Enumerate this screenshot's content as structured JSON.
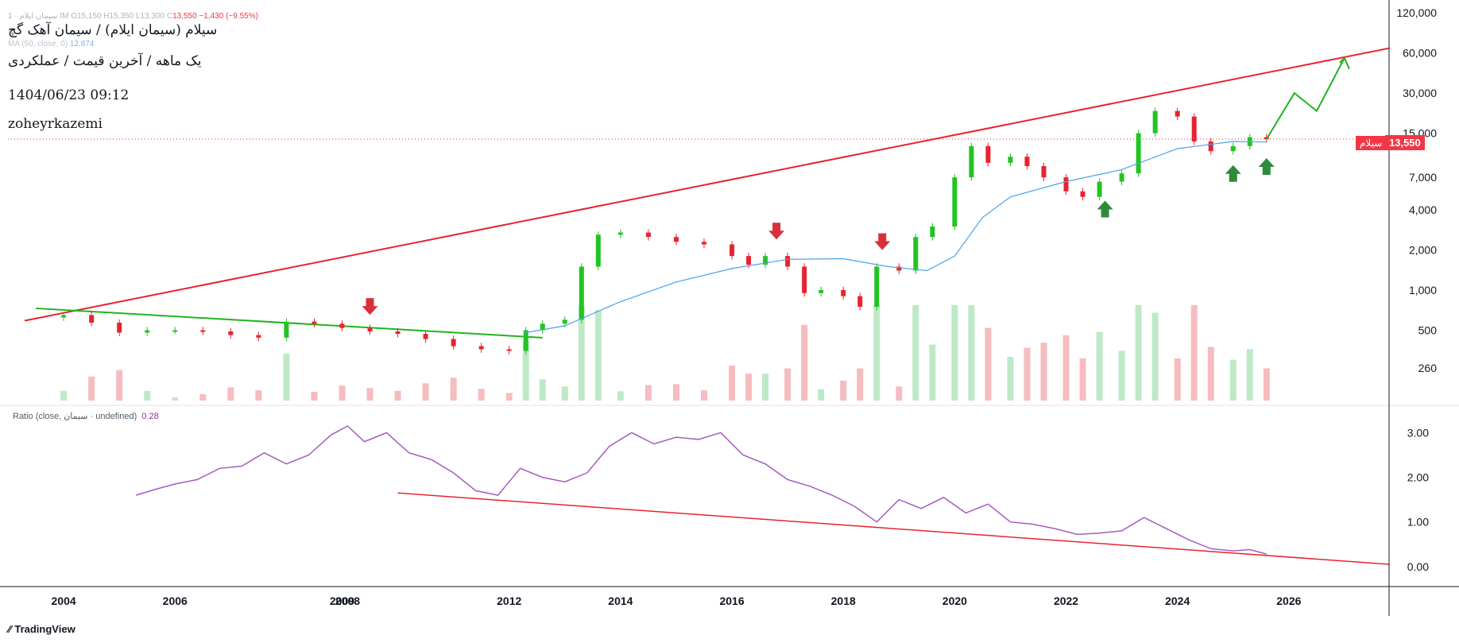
{
  "header": {
    "ohlc_prefix": "ا سیمان ایلام · 1M",
    "ohlc_values": "O15,150 H15,350 L13,300 C",
    "ohlc_close": "13,550 −1,430 (−9.55%)",
    "title": "سیلام (سیمان ایلام) / سیمان آهک گچ",
    "subtitle": "یک ماهه / آخرین قیمت / عملکردی",
    "datetime": "1404/06/23 09:12",
    "author": "zoheyrkazemi",
    "ma_label": "MA (50, close, 0)",
    "ma_value": "12,874"
  },
  "price_badge": {
    "symbol": "سیلام",
    "value": "13,550"
  },
  "ratio_legend": {
    "label": "Ratio (close, سیمان · undefined)",
    "value": "0.28"
  },
  "footer": {
    "brand": "TradingView"
  },
  "colors": {
    "up": "#22c422",
    "down": "#e8232f",
    "ma": "#4aa3e8",
    "ratio": "#a55cbf",
    "trend_red": "#e8232f",
    "trend_green": "#22b31e",
    "arrow_red": "#d8303a",
    "arrow_green": "#2e8b3a"
  },
  "chart_data": [
    {
      "type": "candlestick",
      "scale": "log",
      "price_axis_ticks": [
        "120,000",
        "60,000",
        "30,000",
        "15,000",
        "7,000",
        "4,000",
        "2,000",
        "1,000",
        "500",
        "260"
      ],
      "x_axis_ticks": [
        "2004",
        "2006",
        "2008",
        "2009",
        "2012",
        "2014",
        "2016",
        "2018",
        "2020",
        "2022",
        "2024",
        "2026"
      ],
      "ylim": [
        180,
        120000
      ],
      "xlim": [
        2003.0,
        2027.8
      ],
      "last_price": 13550,
      "series": [
        {
          "name": "close",
          "x": [
            2004.0,
            2004.5,
            2005.0,
            2005.5,
            2006.0,
            2006.5,
            2007.0,
            2007.5,
            2008.0,
            2008.5,
            2009.0,
            2009.5,
            2010.0,
            2010.5,
            2011.0,
            2011.5,
            2012.0,
            2012.3,
            2012.6,
            2013.0,
            2013.3,
            2013.6,
            2014.0,
            2014.5,
            2015.0,
            2015.5,
            2016.0,
            2016.3,
            2016.6,
            2017.0,
            2017.3,
            2017.6,
            2018.0,
            2018.3,
            2018.6,
            2019.0,
            2019.3,
            2019.6,
            2020.0,
            2020.3,
            2020.6,
            2021.0,
            2021.3,
            2021.6,
            2022.0,
            2022.3,
            2022.6,
            2023.0,
            2023.3,
            2023.6,
            2024.0,
            2024.3,
            2024.6,
            2025.0,
            2025.3,
            2025.6
          ],
          "values": [
            650,
            570,
            480,
            500,
            500,
            490,
            460,
            440,
            580,
            560,
            520,
            490,
            470,
            430,
            380,
            360,
            350,
            500,
            560,
            600,
            1500,
            2600,
            2700,
            2500,
            2300,
            2200,
            1800,
            1550,
            1800,
            1500,
            950,
            1000,
            900,
            750,
            1500,
            1400,
            2500,
            3000,
            7000,
            12000,
            9000,
            10000,
            8500,
            7000,
            5500,
            5000,
            6500,
            7500,
            15000,
            22000,
            20000,
            13000,
            11000,
            12000,
            14000,
            13550
          ]
        },
        {
          "name": "MA 50",
          "x": [
            2012.3,
            2013.0,
            2014.0,
            2015.0,
            2016.0,
            2017.0,
            2018.0,
            2018.8,
            2019.5,
            2020.0,
            2020.5,
            2021.0,
            2022.0,
            2023.0,
            2024.0,
            2025.0,
            2025.6
          ],
          "values": [
            480,
            540,
            820,
            1150,
            1450,
            1700,
            1720,
            1500,
            1400,
            1800,
            3500,
            5000,
            6500,
            8000,
            11500,
            13000,
            12874
          ]
        }
      ],
      "annotations": {
        "red_trendline": {
          "from": [
            2003.3,
            590
          ],
          "to": [
            2027.8,
            65000
          ]
        },
        "green_trendline": {
          "from": [
            2003.5,
            730
          ],
          "to": [
            2012.6,
            440
          ]
        },
        "green_projection": {
          "x": [
            2025.6,
            2026.1,
            2026.5,
            2027.0
          ],
          "values": [
            13550,
            30000,
            22000,
            55000
          ]
        },
        "red_down_arrows_x": [
          2009.5,
          2016.8,
          2018.7
        ],
        "green_up_arrows_x": [
          2022.7,
          2025.0,
          2025.6
        ]
      }
    },
    {
      "type": "line",
      "name": "Ratio (close, سیمان · undefined)",
      "y_axis_ticks": [
        "3.00",
        "2.00",
        "1.00",
        "0.00"
      ],
      "ylim": [
        -0.2,
        3.4
      ],
      "last_value": 0.28,
      "series": [
        {
          "name": "ratio",
          "x": [
            2005.3,
            2005.7,
            2006.0,
            2006.4,
            2006.8,
            2007.2,
            2007.6,
            2008.0,
            2008.4,
            2008.8,
            2009.1,
            2009.4,
            2009.8,
            2010.2,
            2010.6,
            2011.0,
            2011.4,
            2011.8,
            2012.2,
            2012.6,
            2013.0,
            2013.4,
            2013.8,
            2014.2,
            2014.6,
            2015.0,
            2015.4,
            2015.8,
            2016.2,
            2016.6,
            2017.0,
            2017.4,
            2017.8,
            2018.2,
            2018.6,
            2019.0,
            2019.4,
            2019.8,
            2020.2,
            2020.6,
            2021.0,
            2021.4,
            2021.8,
            2022.2,
            2022.6,
            2023.0,
            2023.4,
            2023.8,
            2024.2,
            2024.6,
            2025.0,
            2025.3,
            2025.6
          ],
          "values": [
            1.6,
            1.75,
            1.85,
            1.95,
            2.2,
            2.25,
            2.55,
            2.3,
            2.5,
            2.95,
            3.15,
            2.8,
            3.0,
            2.55,
            2.4,
            2.1,
            1.7,
            1.6,
            2.2,
            2.0,
            1.9,
            2.1,
            2.7,
            3.0,
            2.75,
            2.9,
            2.85,
            3.0,
            2.5,
            2.3,
            1.95,
            1.8,
            1.6,
            1.35,
            1.0,
            1.5,
            1.3,
            1.55,
            1.2,
            1.4,
            1.0,
            0.95,
            0.85,
            0.72,
            0.75,
            0.8,
            1.1,
            0.85,
            0.6,
            0.4,
            0.35,
            0.38,
            0.28
          ]
        }
      ],
      "annotations": {
        "red_trendline": {
          "from": [
            2010.0,
            1.65
          ],
          "to": [
            2027.8,
            0.05
          ]
        }
      }
    }
  ]
}
